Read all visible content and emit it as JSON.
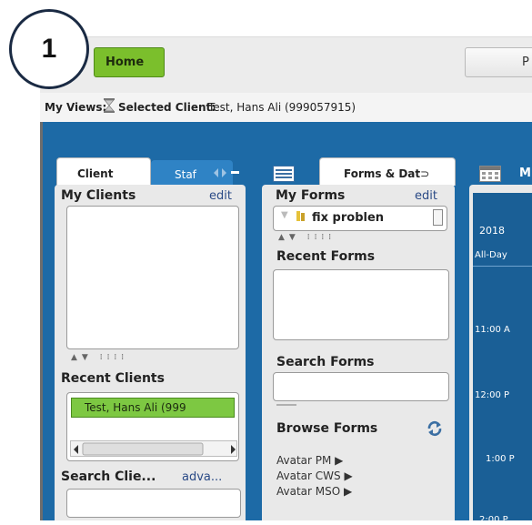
{
  "callout": {
    "number": "1"
  },
  "topbar": {
    "home_label": "Home",
    "second_button_label": "P"
  },
  "views": {
    "my_views_label": "My Views:",
    "selected_client_label": "Selected Client:",
    "selected_client_value": "Test, Hans Ali (999057915)"
  },
  "client_panel": {
    "tab_client": "Client",
    "tab_staff": "Staf",
    "my_clients_label": "My Clients",
    "edit_label": "edit",
    "recent_clients_label": "Recent Clients",
    "recent_clients": [
      "Test, Hans Ali (999"
    ],
    "search_clients_label": "Search Clie...",
    "advanced_label": "adva..."
  },
  "forms_panel": {
    "tab_forms": "Forms & Dat",
    "my_forms_label": "My Forms",
    "edit_label": "edit",
    "my_forms_item": "fix problen",
    "recent_forms_label": "Recent Forms",
    "search_forms_label": "Search Forms",
    "browse_forms_label": "Browse Forms",
    "browse_items": [
      "Avatar PM ▶",
      "Avatar CWS ▶",
      "Avatar MSO ▶"
    ]
  },
  "calendar": {
    "tab_label": "M",
    "year": "2018",
    "all_day": "All-Day",
    "times": [
      "11:00 A",
      "12:00 P",
      "1:00 P",
      "2:00 P"
    ]
  },
  "colors": {
    "brand_green": "#7bbf2c",
    "workspace_blue": "#1d6aa6",
    "selected_row": "#7dc842"
  }
}
